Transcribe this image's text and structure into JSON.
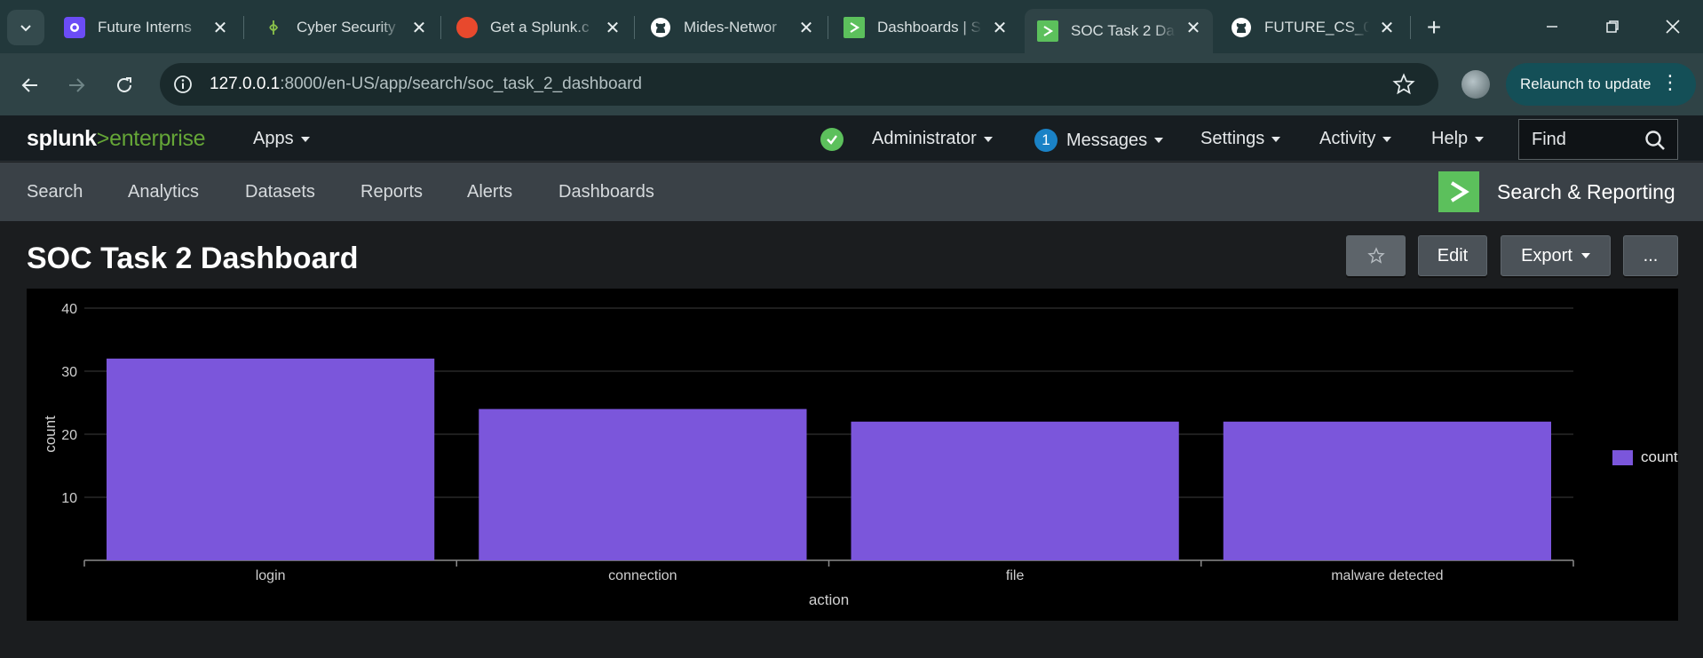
{
  "browser": {
    "tabs": [
      {
        "title": "Future Interns",
        "icon": "future-interns-icon"
      },
      {
        "title": "Cyber Security",
        "icon": "cyber-security-icon"
      },
      {
        "title": "Get a Splunk.c",
        "icon": "splunk-icon"
      },
      {
        "title": "Mides-Networ",
        "icon": "github-icon"
      },
      {
        "title": "Dashboards | S",
        "icon": "splunk-app-icon"
      },
      {
        "title": "SOC Task 2 Da",
        "icon": "splunk-app-icon",
        "active": true
      },
      {
        "title": "FUTURE_CS_0",
        "icon": "github-icon"
      }
    ],
    "url_host": "127.0.0.1",
    "url_path": ":8000/en-US/app/search/soc_task_2_dashboard",
    "relaunch_label": "Relaunch to update"
  },
  "splunk": {
    "logo_brand": "splunk",
    "logo_product": "enterprise",
    "topnav": {
      "apps": "Apps",
      "user": "Administrator",
      "messages_count": "1",
      "messages": "Messages",
      "settings": "Settings",
      "activity": "Activity",
      "help": "Help",
      "find_placeholder": "Find"
    },
    "appnav": [
      "Search",
      "Analytics",
      "Datasets",
      "Reports",
      "Alerts",
      "Dashboards"
    ],
    "app_name": "Search & Reporting"
  },
  "dashboard": {
    "title": "SOC Task 2 Dashboard",
    "buttons": {
      "edit": "Edit",
      "export": "Export",
      "more": "..."
    }
  },
  "chart_data": {
    "type": "bar",
    "categories": [
      "login",
      "connection",
      "file",
      "malware detected"
    ],
    "series": [
      {
        "name": "count",
        "values": [
          32,
          24,
          22,
          22
        ],
        "color": "#7b56db"
      }
    ],
    "xlabel": "action",
    "ylabel": "count",
    "ylim": [
      0,
      40
    ],
    "yticks": [
      10,
      20,
      30,
      40
    ],
    "grid": true,
    "legend_position": "right"
  }
}
